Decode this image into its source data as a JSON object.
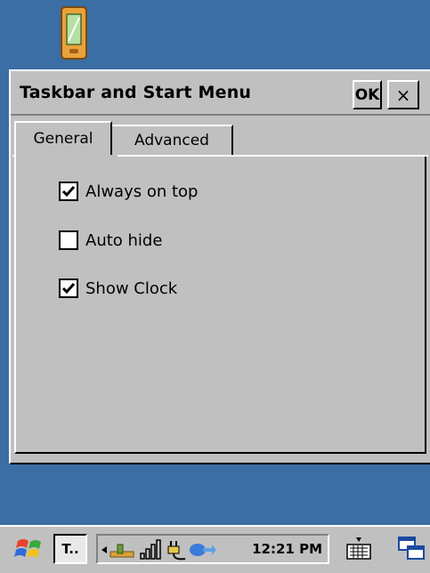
{
  "dialog": {
    "title": "Taskbar and Start Menu",
    "ok_label": "OK",
    "close_label": "×"
  },
  "tabs": [
    {
      "label": "General",
      "selected": true
    },
    {
      "label": "Advanced",
      "selected": false
    }
  ],
  "options": [
    {
      "label": "Always on top",
      "checked": true
    },
    {
      "label": "Auto hide",
      "checked": false
    },
    {
      "label": "Show Clock",
      "checked": true
    }
  ],
  "taskbar": {
    "task_button_label": "T..",
    "clock": "12:21 PM",
    "icons": [
      "start-flag-icon",
      "network-icon",
      "signal-icon",
      "power-plug-icon",
      "connection-icon",
      "keyboard-icon",
      "switch-window-icon"
    ]
  },
  "colors": {
    "desktop": "#3a6ea5",
    "window": "#c0c0c0"
  }
}
